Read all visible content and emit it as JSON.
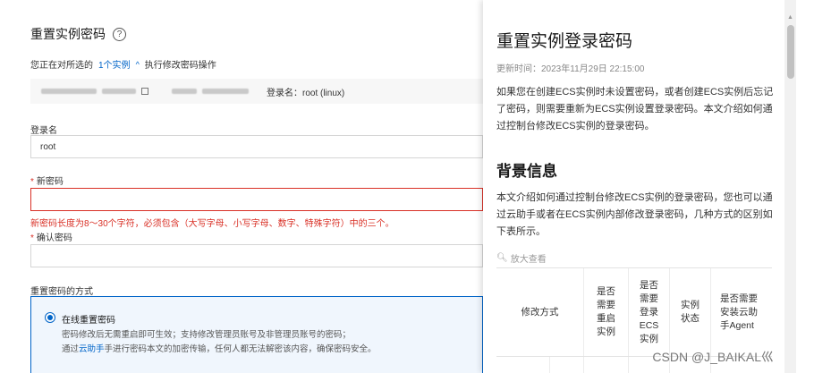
{
  "form": {
    "title": "重置实例密码",
    "selected_prefix": "您正在对所选的",
    "selected_link": "1个实例",
    "selected_suffix": "执行修改密码操作",
    "instance_login": "登录名：root (linux)",
    "login_label": "登录名",
    "login_value": "root",
    "new_password_label": "新密码",
    "new_password_error": "新密码长度为8～30个字符，必须包含（大写字母、小写字母、数字、特殊字符）中的三个。",
    "confirm_password_label": "确认密码",
    "reset_method_label": "重置密码的方式",
    "method": {
      "option": "在线重置密码",
      "desc1": "密码修改后无需重启即可生效；支持修改管理员账号及非管理员账号的密码；",
      "desc2_prefix": "通过",
      "desc2_link": "云助手",
      "desc2_suffix": "手进行密码本文的加密传输，任何人都无法解密该内容，确保密码安全。"
    }
  },
  "doc": {
    "title": "重置实例登录密码",
    "updated": "更新时间：2023年11月29日 22:15:00",
    "intro": "如果您在创建ECS实例时未设置密码，或者创建ECS实例后忘记了密码，则需要重新为ECS实例设置登录密码。本文介绍如何通过控制台修改ECS实例的登录密码。",
    "section_title": "背景信息",
    "section_text": "本文介绍如何通过控制台修改ECS实例的登录密码，您也可以通过云助手或者在ECS实例内部修改登录密码，几种方式的区别如下表所示。",
    "zoom_label": "放大查看",
    "table_headers": [
      "修改方式",
      "是否需要重启实例",
      "是否需要登录ECS实例",
      "实例状态",
      "是否需要安装云助手Agent"
    ]
  },
  "watermark": "CSDN @J_BAIKAL巛"
}
